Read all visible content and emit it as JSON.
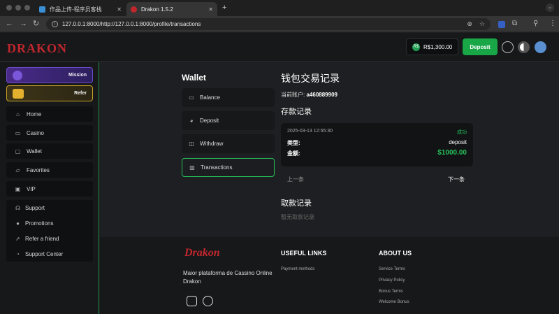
{
  "browser": {
    "tabs": [
      {
        "title": "作品上传-程序员客栈",
        "close": "✕"
      },
      {
        "title": "Drakon 1.5.2",
        "close": "✕"
      }
    ],
    "new_tab": "+",
    "url": "127.0.0.1:8000/http://127.0.0.1:8000/profile/transactions"
  },
  "header": {
    "logo": "DRAKON",
    "balance": "R$1,300.00",
    "balance_coin": "R$",
    "deposit_label": "Deposit"
  },
  "sidebar": {
    "mission_label": "Mission",
    "refer_label": "Refer",
    "items": [
      {
        "label": "Home",
        "icon": "home-icon"
      },
      {
        "label": "Casino",
        "icon": "gamepad-icon"
      },
      {
        "label": "Wallet",
        "icon": "wallet-icon"
      },
      {
        "label": "Favorites",
        "icon": "folder-icon"
      },
      {
        "label": "VIP",
        "icon": "vip-icon"
      }
    ],
    "group": [
      {
        "label": "Support",
        "icon": "headset-icon"
      },
      {
        "label": "Promotions",
        "icon": "promo-icon"
      },
      {
        "label": "Refer a friend",
        "icon": "share-icon"
      },
      {
        "label": "Support Center",
        "icon": "chat-icon"
      }
    ]
  },
  "wallet": {
    "title": "Wallet",
    "nav": [
      {
        "label": "Balance",
        "icon": "balance-icon"
      },
      {
        "label": "Deposit",
        "icon": "piggy-icon"
      },
      {
        "label": "Withdraw",
        "icon": "withdraw-icon"
      },
      {
        "label": "Transactions",
        "icon": "chart-icon",
        "active": true
      }
    ]
  },
  "transactions": {
    "title": "钱包交易记录",
    "account_label": "当前账户:",
    "account_id": "a460889909",
    "deposit_section": "存款记录",
    "record": {
      "timestamp": "2025-03-13 12:55:30",
      "status": "成功",
      "type_label": "类型:",
      "type_value": "deposit",
      "amount_label": "金额:",
      "amount_value": "$1000.00"
    },
    "prev": "上一条",
    "next": "下一条",
    "withdraw_section": "取款记录",
    "withdraw_empty": "暂无取款记录"
  },
  "footer": {
    "logo": "Drakon",
    "description": "Maior plataforma de Cassino Online Drakon",
    "useful_links_title": "USEFUL LINKS",
    "useful_links": [
      "Payment methods"
    ],
    "about_title": "ABOUT US",
    "about_links": [
      "Service Terms",
      "Privacy Policy",
      "Bonus Terms",
      "Welcome Bonus"
    ]
  },
  "colors": {
    "accent": "#18a647",
    "brand": "#c0272d",
    "success": "#25c15b"
  }
}
